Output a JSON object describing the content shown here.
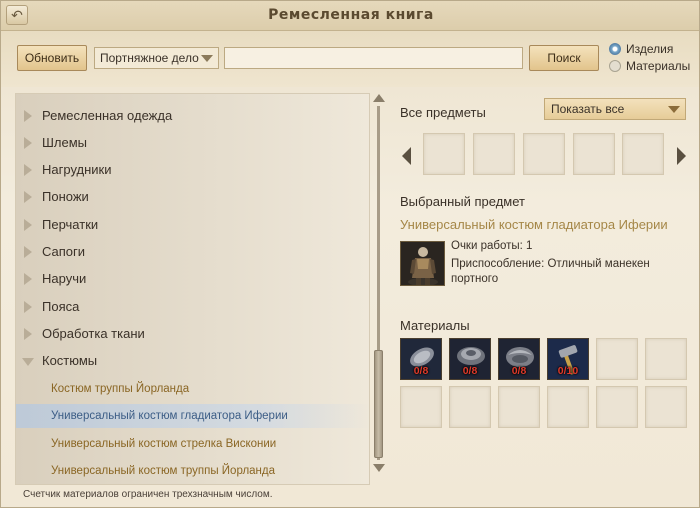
{
  "window": {
    "title": "Ремесленная книга"
  },
  "toolbar": {
    "refresh_label": "Обновить",
    "craft_select_value": "Портняжное дело",
    "search_value": "",
    "search_label": "Поиск",
    "radio_items_label": "Изделия",
    "radio_materials_label": "Материалы",
    "radio_selected": "Изделия"
  },
  "categories": [
    {
      "label": "Ремесленная одежда",
      "expanded": false
    },
    {
      "label": "Шлемы",
      "expanded": false
    },
    {
      "label": "Нагрудники",
      "expanded": false
    },
    {
      "label": "Поножи",
      "expanded": false
    },
    {
      "label": "Перчатки",
      "expanded": false
    },
    {
      "label": "Сапоги",
      "expanded": false
    },
    {
      "label": "Наручи",
      "expanded": false
    },
    {
      "label": "Пояса",
      "expanded": false
    },
    {
      "label": "Обработка ткани",
      "expanded": false
    },
    {
      "label": "Костюмы",
      "expanded": true
    }
  ],
  "subitems": [
    {
      "label": "Костюм труппы Йорланда",
      "selected": false
    },
    {
      "label": "Универсальный костюм гладиатора Иферии",
      "selected": true
    },
    {
      "label": "Универсальный костюм стрелка Висконии",
      "selected": false
    },
    {
      "label": "Универсальный костюм труппы Йорланда",
      "selected": false
    }
  ],
  "footer_note": "Счетчик материалов ограничен трехзначным числом.",
  "all_items": {
    "title": "Все предметы",
    "filter_value": "Показать все",
    "slot_count": 5
  },
  "selected_item": {
    "title": "Выбранный предмет",
    "name": "Универсальный костюм гладиатора Иферии",
    "work_points": "Очки работы:  1",
    "tool_line1": "Приспособление: Отличный манекен",
    "tool_line2": "портного",
    "icon": "gladiator-costume-icon"
  },
  "materials": {
    "title": "Материалы",
    "items": [
      {
        "icon": "fabric-roll-icon",
        "count": "0/8"
      },
      {
        "icon": "thread-spool-icon",
        "count": "0/8"
      },
      {
        "icon": "leather-bundle-icon",
        "count": "0/8"
      },
      {
        "icon": "tool-hammer-icon",
        "count": "0/10"
      }
    ],
    "empty_slots": 8
  },
  "colors": {
    "accent_selected": "#3c5d86",
    "subitem_text": "#8a6624",
    "material_count": "#e03a2a"
  }
}
